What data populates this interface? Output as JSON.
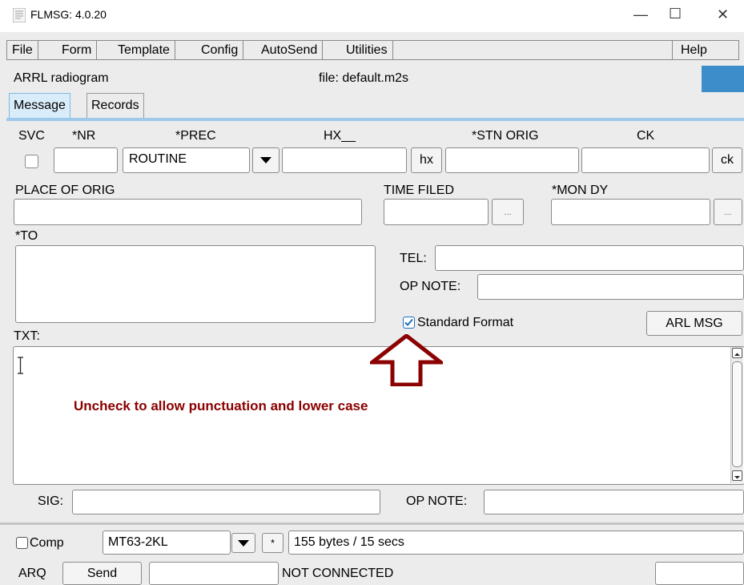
{
  "window": {
    "title": "FLMSG: 4.0.20",
    "controls": {
      "minimize": "—",
      "maximize": "☐",
      "close": "✕"
    }
  },
  "menu": {
    "items": [
      "File",
      "Form",
      "Template",
      "Config",
      "AutoSend",
      "Utilities"
    ],
    "help": "Help"
  },
  "info": {
    "form_name": "ARRL radiogram",
    "file": "file: default.m2s",
    "accent_color": "#3c8dc9"
  },
  "tabs": {
    "message": "Message",
    "records": "Records"
  },
  "header": {
    "svc": "SVC",
    "nr": "*NR",
    "prec": "*PREC",
    "hx": "HX__",
    "stn_orig": "*STN ORIG",
    "ck": "CK",
    "prec_value": "ROUTINE",
    "hx_button": "hx",
    "ck_button": "ck",
    "place_of_orig": "PLACE OF ORIG",
    "time_filed": "TIME FILED",
    "mon_dy": "*MON DY",
    "dots_button": "..."
  },
  "address": {
    "to": "*TO",
    "tel": "TEL:",
    "op_note": "OP NOTE:",
    "standard_format": "Standard Format",
    "standard_format_checked": true,
    "arl_msg_button": "ARL MSG"
  },
  "txt": {
    "label": "TXT:",
    "annotation": "Uncheck to allow punctuation and lower case",
    "annotation_color": "#8b0000"
  },
  "signature": {
    "sig": "SIG:",
    "op_note": "OP NOTE:"
  },
  "transfer": {
    "comp": "Comp",
    "mode": "MT63-2KL",
    "star_button": "*",
    "status": "155 bytes / 15 secs"
  },
  "footer": {
    "arq": "ARQ",
    "send": "Send",
    "connection": "NOT CONNECTED"
  }
}
